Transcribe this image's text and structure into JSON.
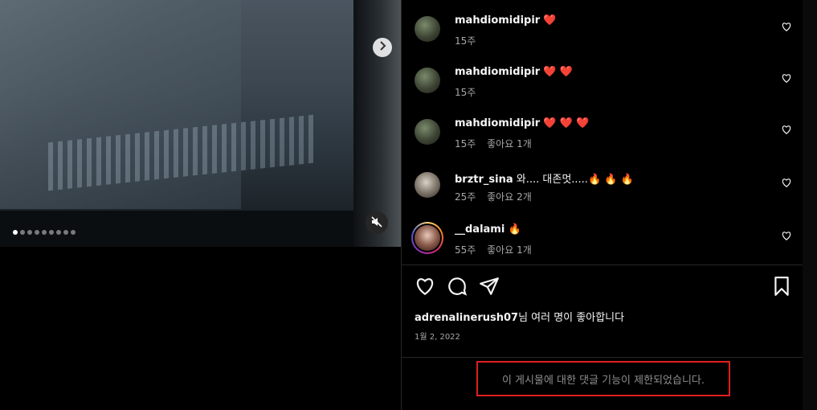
{
  "media": {
    "next_icon": "chevron-right-icon",
    "mute_icon": "speaker-muted-icon",
    "carousel_total": 9,
    "carousel_active_index": 0
  },
  "comments": [
    {
      "username": "mahdiomidipir",
      "text": "❤️",
      "age": "15주",
      "likes": ""
    },
    {
      "username": "mahdiomidipir",
      "text": "❤️ ❤️",
      "age": "15주",
      "likes": ""
    },
    {
      "username": "mahdiomidipir",
      "text": "❤️ ❤️ ❤️",
      "age": "15주",
      "likes": "좋아요 1개"
    },
    {
      "username": "brztr_sina",
      "text": "와.... 대존멋.....🔥 🔥 🔥",
      "age": "25주",
      "likes": "좋아요 2개"
    },
    {
      "username": "__dalami",
      "text": "🔥",
      "age": "55주",
      "likes": "좋아요 1개"
    }
  ],
  "actions": {
    "like_icon": "heart-icon",
    "comment_icon": "comment-icon",
    "share_icon": "send-icon",
    "save_icon": "bookmark-icon"
  },
  "likes_summary": {
    "user": "adrenalinerush07",
    "suffix": "님 여러 명이 좋아합니다"
  },
  "post_date": "1월 2, 2022",
  "restricted_message": "이 게시물에 대한 댓글 기능이 제한되었습니다.",
  "colors": {
    "background": "#000000",
    "secondary_text": "#a8a8a8",
    "highlight_border": "#e01e1e"
  }
}
